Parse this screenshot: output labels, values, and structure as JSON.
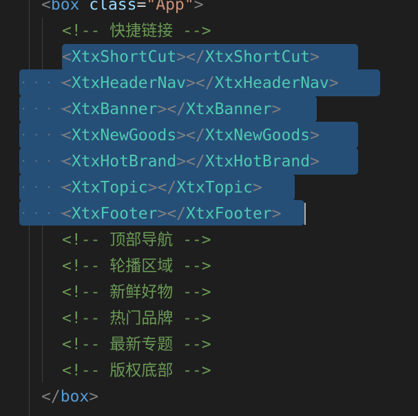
{
  "colors": {
    "background": "#1e1e1e",
    "selection": "#264f78",
    "component_tag": "#4ec9b0",
    "html_tag": "#569cd6",
    "attribute": "#9cdcfe",
    "string": "#ce9178",
    "comment": "#6a9955",
    "punctuation": "#808080"
  },
  "open_tag": {
    "name": "box",
    "attr": "class",
    "value": "\"App\""
  },
  "comment_shortcut": "<!-- 快捷链接 -->",
  "components": [
    "XtxShortCut",
    "XtxHeaderNav",
    "XtxBanner",
    "XtxNewGoods",
    "XtxHotBrand",
    "XtxTopic",
    "XtxFooter"
  ],
  "comments": [
    "<!-- 顶部导航 -->",
    "<!-- 轮播区域 -->",
    "<!-- 新鲜好物 -->",
    "<!-- 热门品牌 -->",
    "<!-- 最新专题 -->",
    "<!-- 版权底部 -->"
  ],
  "close_tag": {
    "name": "box"
  },
  "whitespace_marker": "····"
}
